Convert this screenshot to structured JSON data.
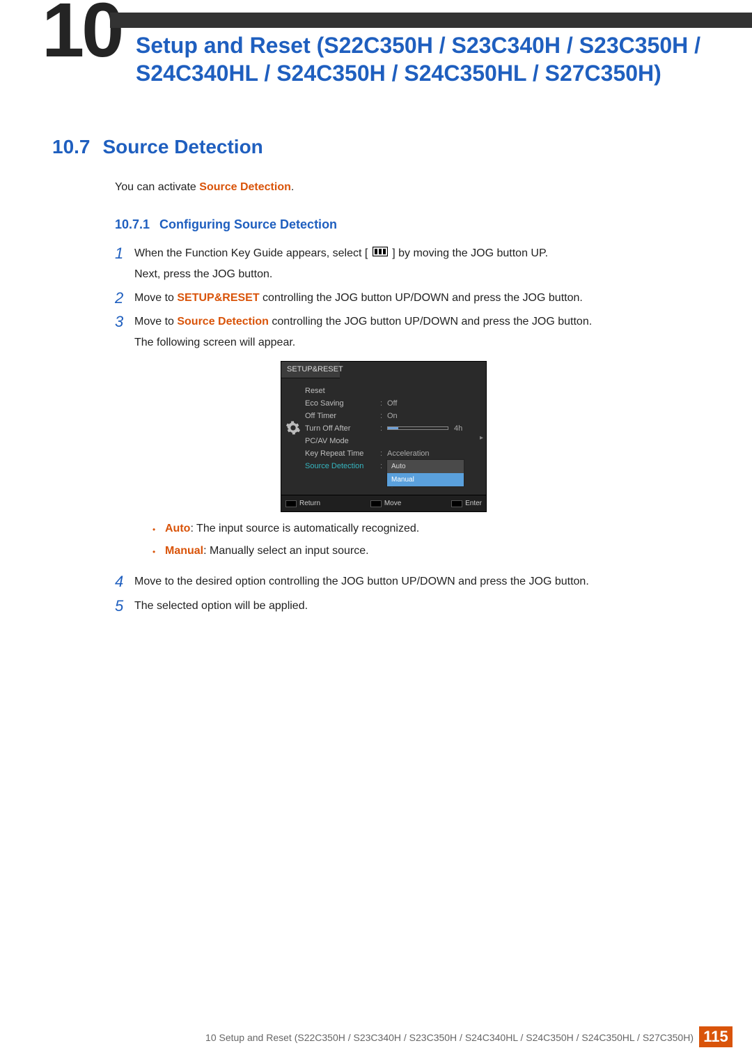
{
  "chapter": {
    "big_number": "10",
    "title": "Setup and Reset (S22C350H / S23C340H / S23C350H / S24C340HL / S24C350H / S24C350HL / S27C350H)"
  },
  "section": {
    "number": "10.7",
    "title": "Source Detection"
  },
  "intro": {
    "prefix": "You can activate ",
    "term": "Source Detection",
    "suffix": "."
  },
  "subsection": {
    "number": "10.7.1",
    "title": "Configuring Source Detection"
  },
  "steps": {
    "s1": {
      "num": "1",
      "a": "When the Function Key Guide appears, select [",
      "b": "] by moving the JOG button UP.",
      "c": "Next, press the JOG button."
    },
    "s2": {
      "num": "2",
      "a": "Move to ",
      "hl": "SETUP&RESET",
      "b": " controlling the JOG button UP/DOWN and press the JOG button."
    },
    "s3": {
      "num": "3",
      "a": "Move to ",
      "hl": "Source Detection",
      "b": " controlling the JOG button UP/DOWN and press the JOG button.",
      "c": "The following screen will appear."
    },
    "s4": {
      "num": "4",
      "a": "Move to the desired option controlling the JOG button UP/DOWN and press the JOG button."
    },
    "s5": {
      "num": "5",
      "a": "The selected option will be applied."
    }
  },
  "osd": {
    "tab": "SETUP&RESET",
    "rows": {
      "reset": "Reset",
      "eco": "Eco Saving",
      "eco_val": "Off",
      "offtimer": "Off Timer",
      "offtimer_val": "On",
      "turnoff": "Turn Off After",
      "turnoff_val": "4h",
      "pcav": "PC/AV Mode",
      "keyrepeat": "Key Repeat Time",
      "keyrepeat_val": "Acceleration",
      "srcdet": "Source Detection",
      "srcdet_val": "Auto"
    },
    "dropdown": {
      "opt1": "Auto",
      "opt2": "Manual"
    },
    "footer": {
      "return": "Return",
      "move": "Move",
      "enter": "Enter"
    }
  },
  "bullets": {
    "auto_label": "Auto",
    "auto_text": ": The input source is automatically recognized.",
    "manual_label": "Manual",
    "manual_text": ": Manually select an input source."
  },
  "footer": {
    "line": "10 Setup and Reset (S22C350H / S23C340H / S23C350H / S24C340HL / S24C350H / S24C350HL / S27C350H)",
    "page": "115"
  }
}
